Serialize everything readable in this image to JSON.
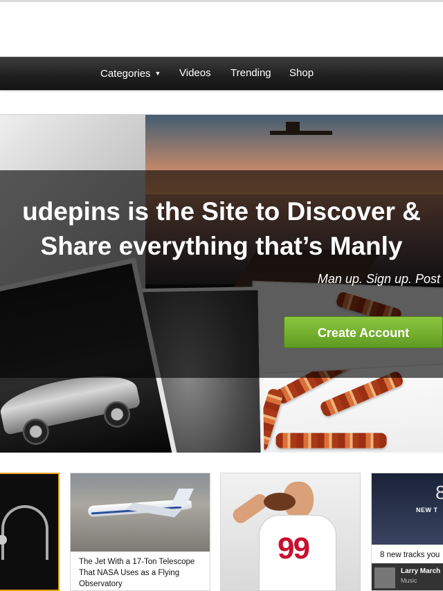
{
  "nav": {
    "items": [
      {
        "label": "Categories",
        "has_dropdown": true
      },
      {
        "label": "Videos"
      },
      {
        "label": "Trending"
      },
      {
        "label": "Shop"
      }
    ]
  },
  "hero": {
    "headline_line1": "udepins is the Site to Discover &",
    "headline_line2": "Share everything that’s Manly",
    "tagline": "Man up. Sign up. Post",
    "cta_label": "Create Account",
    "cta_color": "#6aa72c"
  },
  "cards": [
    {
      "title": ""
    },
    {
      "title": "The Jet With a 17-Ton Telescope That NASA Uses as a Flying Observatory"
    },
    {
      "title": "",
      "jersey_number": "99"
    },
    {
      "title": "8 new tracks you",
      "album_text": "NEW T",
      "album_number": "8",
      "artist": "Larry March",
      "genre": "Music"
    }
  ]
}
